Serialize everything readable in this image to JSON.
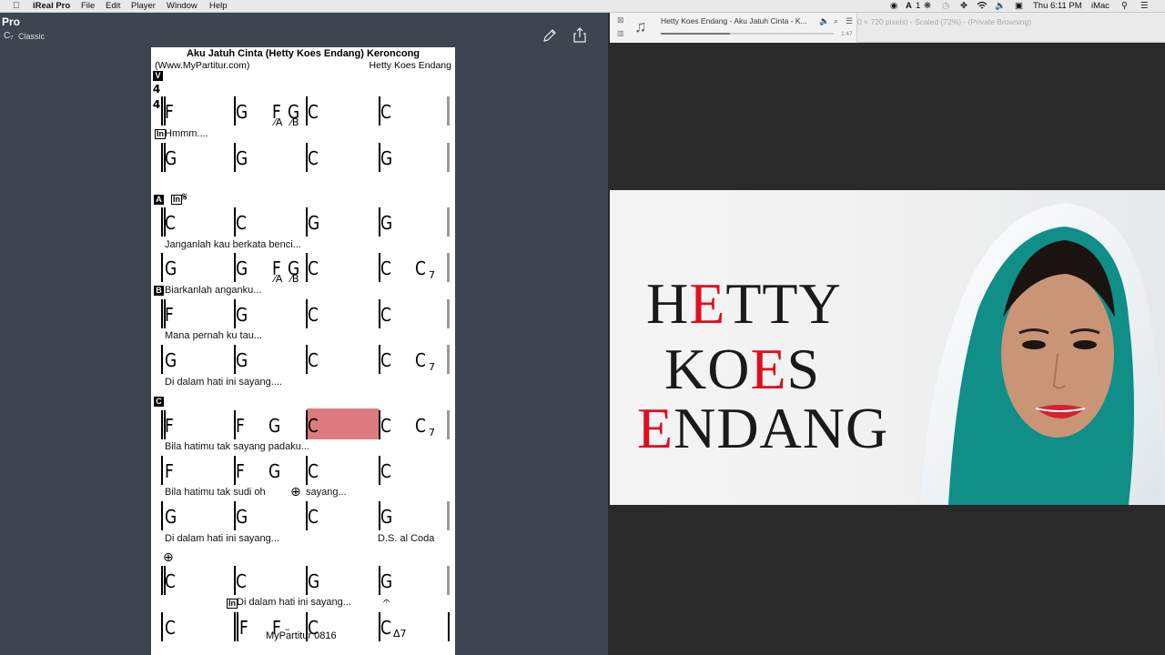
{
  "menubar": {
    "app": "iReal Pro",
    "menus": [
      "File",
      "Edit",
      "Player",
      "Window",
      "Help"
    ],
    "status": {
      "ai_count": "1",
      "clock": "Thu 6:11 PM",
      "computer": "iMac"
    }
  },
  "ireal": {
    "title": "Pro",
    "style": "Classic",
    "style_icon": "C₇",
    "tools": [
      "edit-icon",
      "share-icon"
    ]
  },
  "sheet": {
    "title": "Aku Jatuh Cinta (Hetty Koes Endang) Keroncong",
    "source": "(Www.MyPartitur.com)",
    "composer": "Hetty Koes Endang",
    "time_signature": [
      "4",
      "4"
    ],
    "sections": [
      "V",
      "A",
      "B",
      "C"
    ],
    "rows": [
      {
        "chords": [
          "F",
          "G",
          "F G|C",
          "C"
        ]
      },
      {
        "chords": [
          "G",
          "G",
          "C",
          "G"
        ]
      },
      {
        "chords": [
          "C",
          "C",
          "G",
          "G"
        ]
      },
      {
        "chords": [
          "G",
          "G",
          "F G|C",
          "C C7"
        ]
      },
      {
        "chords": [
          "F",
          "G",
          "C",
          "C"
        ]
      },
      {
        "chords": [
          "G",
          "G",
          "C",
          "C C7"
        ]
      },
      {
        "chords": [
          "F",
          "F G",
          "C",
          "C C7"
        ]
      },
      {
        "chords": [
          "F",
          "F G",
          "C",
          "C"
        ]
      },
      {
        "chords": [
          "G",
          "G",
          "C",
          "G"
        ]
      },
      {
        "chords": [
          "C",
          "C",
          "G",
          "G"
        ]
      },
      {
        "chords": [
          "C",
          "F F-",
          "C",
          "CΔ7"
        ]
      }
    ],
    "slashes": [
      "A",
      "B"
    ],
    "lyrics": {
      "l1": "Hmmm....",
      "l2": "Janganlah kau berkata benci...",
      "l3": "Biarkanlah anganku...",
      "l4": "Mana pernah ku tau...",
      "l5": "Di dalam hati ini sayang....",
      "l6": "Bila hatimu tak sayang padaku...",
      "l7a": "Bila hatimu tak sudi oh",
      "l7b": "sayang...",
      "l8": "Di dalam hati ini sayang...",
      "l9": "Di dalam hati ini sayang..."
    },
    "ds": "D.S. al Coda",
    "in_label": "In",
    "seg_label": "In",
    "footer": "MyPartitur 0816",
    "highlight_color": "#dd7b80"
  },
  "player": {
    "track": "Hetty Koes Endang - Aku Jatuh Cinta - K...",
    "time": "1:47",
    "progress": 0.4,
    "browser_hint": "0 × 720 pixels) - Scaled (72%) - (Private Browsing)"
  },
  "banner": {
    "line1": [
      "H",
      "E",
      "TTY"
    ],
    "line2": [
      "KO",
      "E",
      "S"
    ],
    "line3": [
      "E",
      "NDANG"
    ],
    "accent": "#e00d1e"
  }
}
